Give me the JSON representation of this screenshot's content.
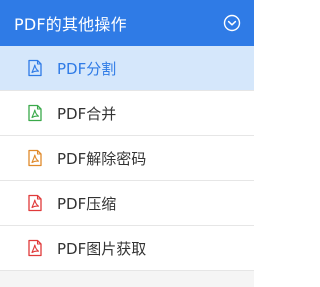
{
  "panel": {
    "title": "PDF的其他操作",
    "collapse_icon": "chevron-down-circle-icon",
    "accent_color": "#2f7be6"
  },
  "menu": {
    "items": [
      {
        "label": "PDF分割",
        "icon": "pdf-split-icon",
        "icon_color": "#2f7be6",
        "active": true
      },
      {
        "label": "PDF合并",
        "icon": "pdf-merge-icon",
        "icon_color": "#3aa94a",
        "active": false
      },
      {
        "label": "PDF解除密码",
        "icon": "pdf-unlock-icon",
        "icon_color": "#e08a2b",
        "active": false
      },
      {
        "label": "PDF压缩",
        "icon": "pdf-compress-icon",
        "icon_color": "#e03a3a",
        "active": false
      },
      {
        "label": "PDF图片获取",
        "icon": "pdf-image-extract-icon",
        "icon_color": "#e03a3a",
        "active": false
      }
    ]
  }
}
